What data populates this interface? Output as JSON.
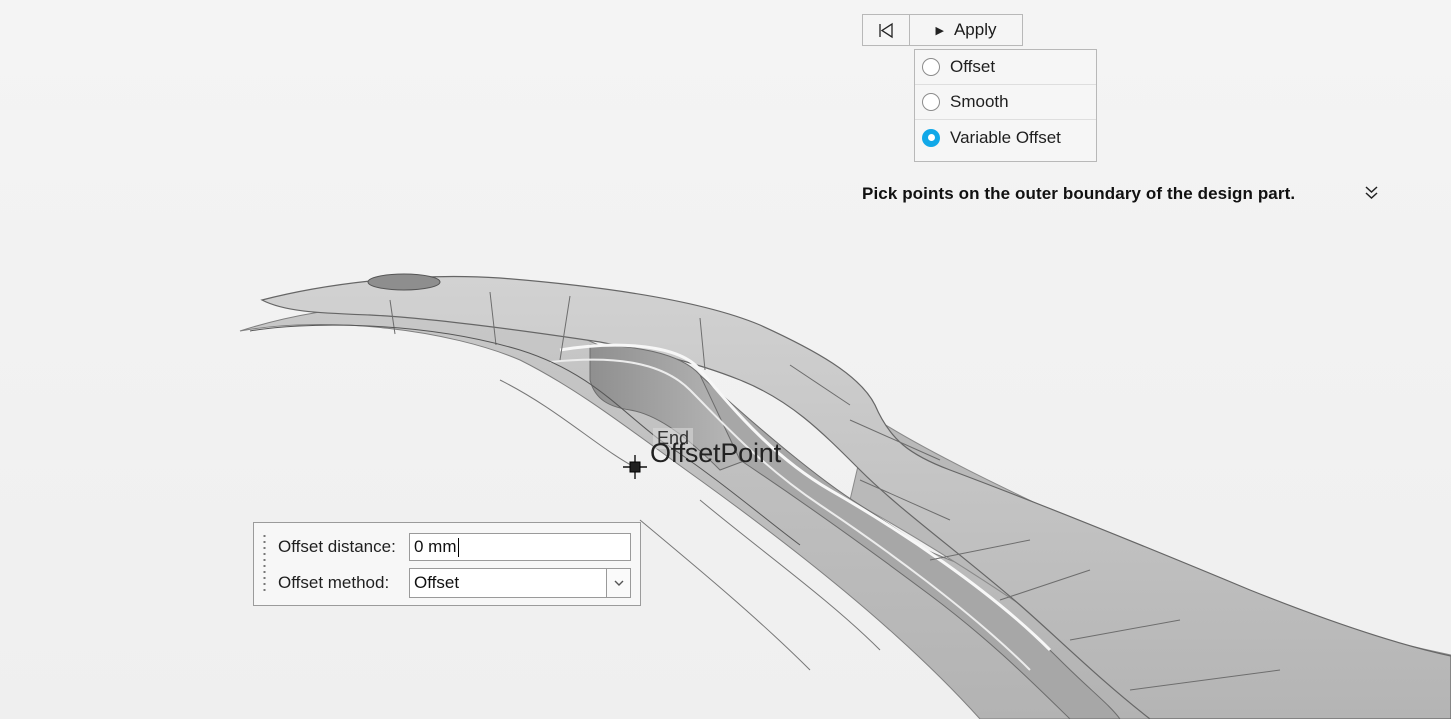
{
  "toolbar": {
    "rewind_icon": "rewind-start-icon",
    "apply_icon": "play-icon",
    "apply_label": "Apply"
  },
  "method_options": [
    {
      "label": "Offset",
      "selected": false
    },
    {
      "label": "Smooth",
      "selected": false
    },
    {
      "label": "Variable Offset",
      "selected": true
    }
  ],
  "instruction": {
    "text": "Pick points on the outer boundary of the design part.",
    "expand_icon": "double-chevron-down-icon"
  },
  "viewport": {
    "snap_label": "End",
    "point_label": "OffsetPoint"
  },
  "offset_dialog": {
    "distance_label": "Offset distance:",
    "distance_value": "0 mm",
    "method_label": "Offset method:",
    "method_value": "Offset"
  },
  "colors": {
    "accent": "#11a8e8",
    "background": "#f2f2f2",
    "model_gray": "#b8b8b8"
  }
}
